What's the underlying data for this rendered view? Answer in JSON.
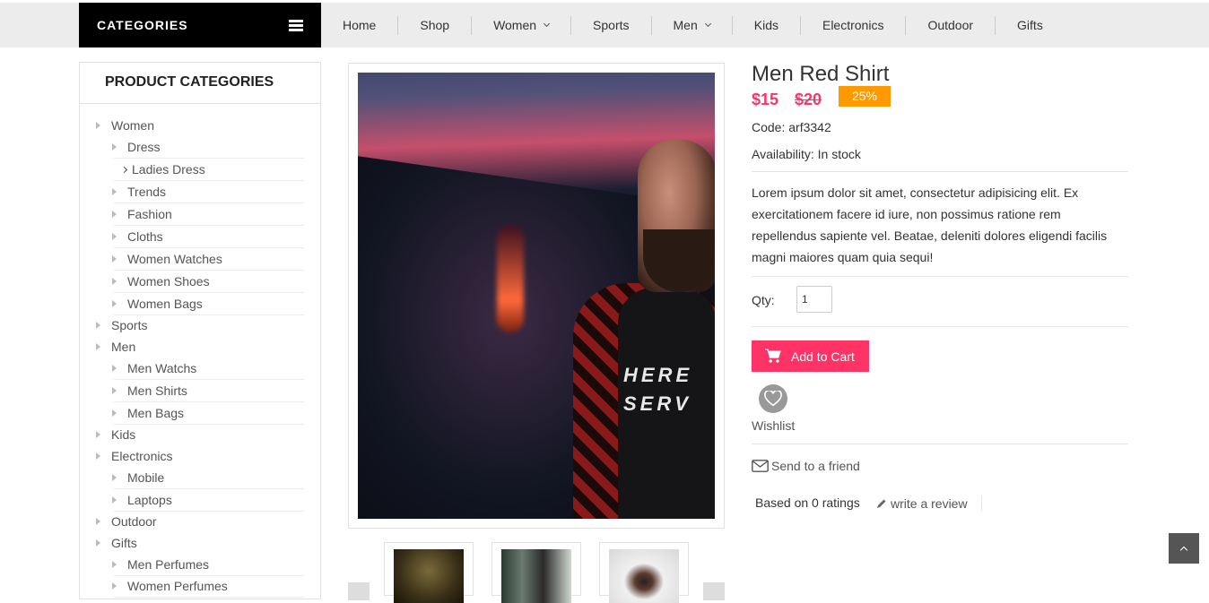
{
  "header": {
    "categories_label": "CATEGORIES",
    "nav": [
      {
        "label": "Home",
        "dropdown": false
      },
      {
        "label": "Shop",
        "dropdown": false
      },
      {
        "label": "Women",
        "dropdown": true
      },
      {
        "label": "Sports",
        "dropdown": false
      },
      {
        "label": "Men",
        "dropdown": true
      },
      {
        "label": "Kids",
        "dropdown": false
      },
      {
        "label": "Electronics",
        "dropdown": false
      },
      {
        "label": "Outdoor",
        "dropdown": false
      },
      {
        "label": "Gifts",
        "dropdown": false
      }
    ]
  },
  "sidebar": {
    "title": "PRODUCT CATEGORIES",
    "items": [
      {
        "label": "Women",
        "level": 0
      },
      {
        "label": "Dress",
        "level": 1
      },
      {
        "label": "Ladies Dress",
        "level": 2
      },
      {
        "label": "Trends",
        "level": 1
      },
      {
        "label": "Fashion",
        "level": 1
      },
      {
        "label": "Cloths",
        "level": 1
      },
      {
        "label": "Women Watches",
        "level": 1
      },
      {
        "label": "Women Shoes",
        "level": 1
      },
      {
        "label": "Women Bags",
        "level": 1
      },
      {
        "label": "Sports",
        "level": 0
      },
      {
        "label": "Men",
        "level": 0
      },
      {
        "label": "Men Watchs",
        "level": 1
      },
      {
        "label": "Men Shirts",
        "level": 1
      },
      {
        "label": "Men Bags",
        "level": 1
      },
      {
        "label": "Kids",
        "level": 0
      },
      {
        "label": "Electronics",
        "level": 0
      },
      {
        "label": "Mobile",
        "level": 1
      },
      {
        "label": "Laptops",
        "level": 1
      },
      {
        "label": "Outdoor",
        "level": 0
      },
      {
        "label": "Gifts",
        "level": 0
      },
      {
        "label": "Men Perfumes",
        "level": 1
      },
      {
        "label": "Women Perfumes",
        "level": 1
      }
    ]
  },
  "gallery": {
    "shirt_print_line1": "HERE",
    "shirt_print_line2": "SERV"
  },
  "product": {
    "title": "Men Red Shirt",
    "price": "$15",
    "old_price": "$20",
    "discount_badge": "25%",
    "code": "Code: arf3342",
    "availability": "Availability: In stock",
    "description": "Lorem ipsum dolor sit amet, consectetur adipisicing elit. Ex exercitationem facere id iure, non possimus ratione rem repellendus sapiente vel. Beatae, deleniti dolores eligendi facilis magni maiores quam quia sequi!",
    "qty_label": "Qty:",
    "qty_value": "1",
    "add_to_cart": "Add to Cart",
    "wishlist": "Wishlist",
    "send_to_friend": "Send to a friend",
    "ratings": "Based on 0 ratings",
    "write_review": "write a review"
  },
  "colors": {
    "accent": "#ff3366",
    "badge": "#ff9900",
    "topbar": "#ececec"
  }
}
